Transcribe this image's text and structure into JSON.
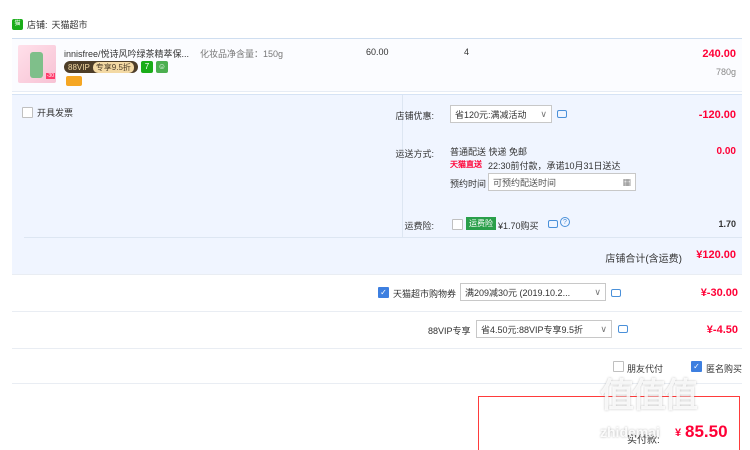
{
  "shop": {
    "label": "店铺:",
    "name": "天猫超市",
    "icon": "shop-icon"
  },
  "item": {
    "title": "innisfree/悦诗风吟绿茶精萃保...",
    "spec": "化妆品净含量：150g",
    "price": "60.00",
    "qty": "4",
    "subtotal": "240.00",
    "weight": "780g",
    "vip_label": "88VIP",
    "vip_discount": "专享9.5折",
    "badge_7": "7",
    "thumb_tag": "-30"
  },
  "invoice": {
    "label": "开具发票"
  },
  "shop_discount": {
    "label": "店铺优惠:",
    "value": "省120元:满减活动",
    "amount": "-120.00"
  },
  "delivery": {
    "label": "运送方式:",
    "method": "普通配送 快递 免邮",
    "tmall_logo": "天猫直送",
    "promise": "22:30前付款，承诺10月31日送达",
    "amount": "0.00",
    "schedule_label": "预约时间",
    "schedule_placeholder": "可预约配送时间"
  },
  "insurance": {
    "label": "运费险:",
    "tag": "运费险",
    "price": "¥1.70购买",
    "amount": "1.70"
  },
  "shop_total": {
    "label": "店铺合计(含运费)",
    "amount": "¥120.00"
  },
  "coupon": {
    "label": "天猫超市购物券",
    "value": "满209减30元 (2019.10.2...",
    "amount": "¥-30.00"
  },
  "vip88": {
    "label": "88VIP专享",
    "value": "省4.50元:88VIP专享9.5折",
    "amount": "¥-4.50"
  },
  "options": {
    "friend_pay": "朋友代付",
    "anonymous": "匿名购买"
  },
  "pay": {
    "label": "实付款:",
    "currency": "¥",
    "amount": "85.50"
  },
  "watermark": "值 什么值得买 zhidemai",
  "colors": {
    "accent": "#ff0036",
    "blue": "#3d7fe0",
    "panel": "#f0f5ff"
  }
}
